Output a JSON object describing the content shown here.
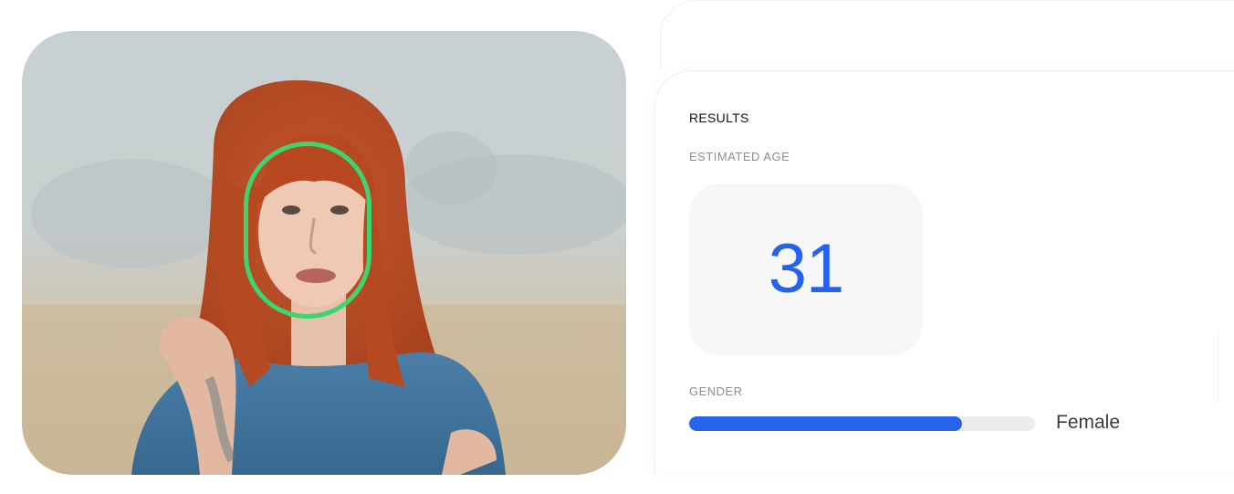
{
  "results": {
    "title": "RESULTS",
    "estimated_age_label": "ESTIMATED AGE",
    "estimated_age_value": "31",
    "gender_label": "GENDER",
    "gender_value": "Female",
    "gender_confidence": 0.79
  },
  "colors": {
    "accent": "#2563eb",
    "face_box": "#3dd56d",
    "track": "#ebebeb",
    "age_box_bg": "#f7f7f7"
  },
  "icons": {
    "photo": "portrait-photo",
    "face_box": "face-detection-outline"
  }
}
